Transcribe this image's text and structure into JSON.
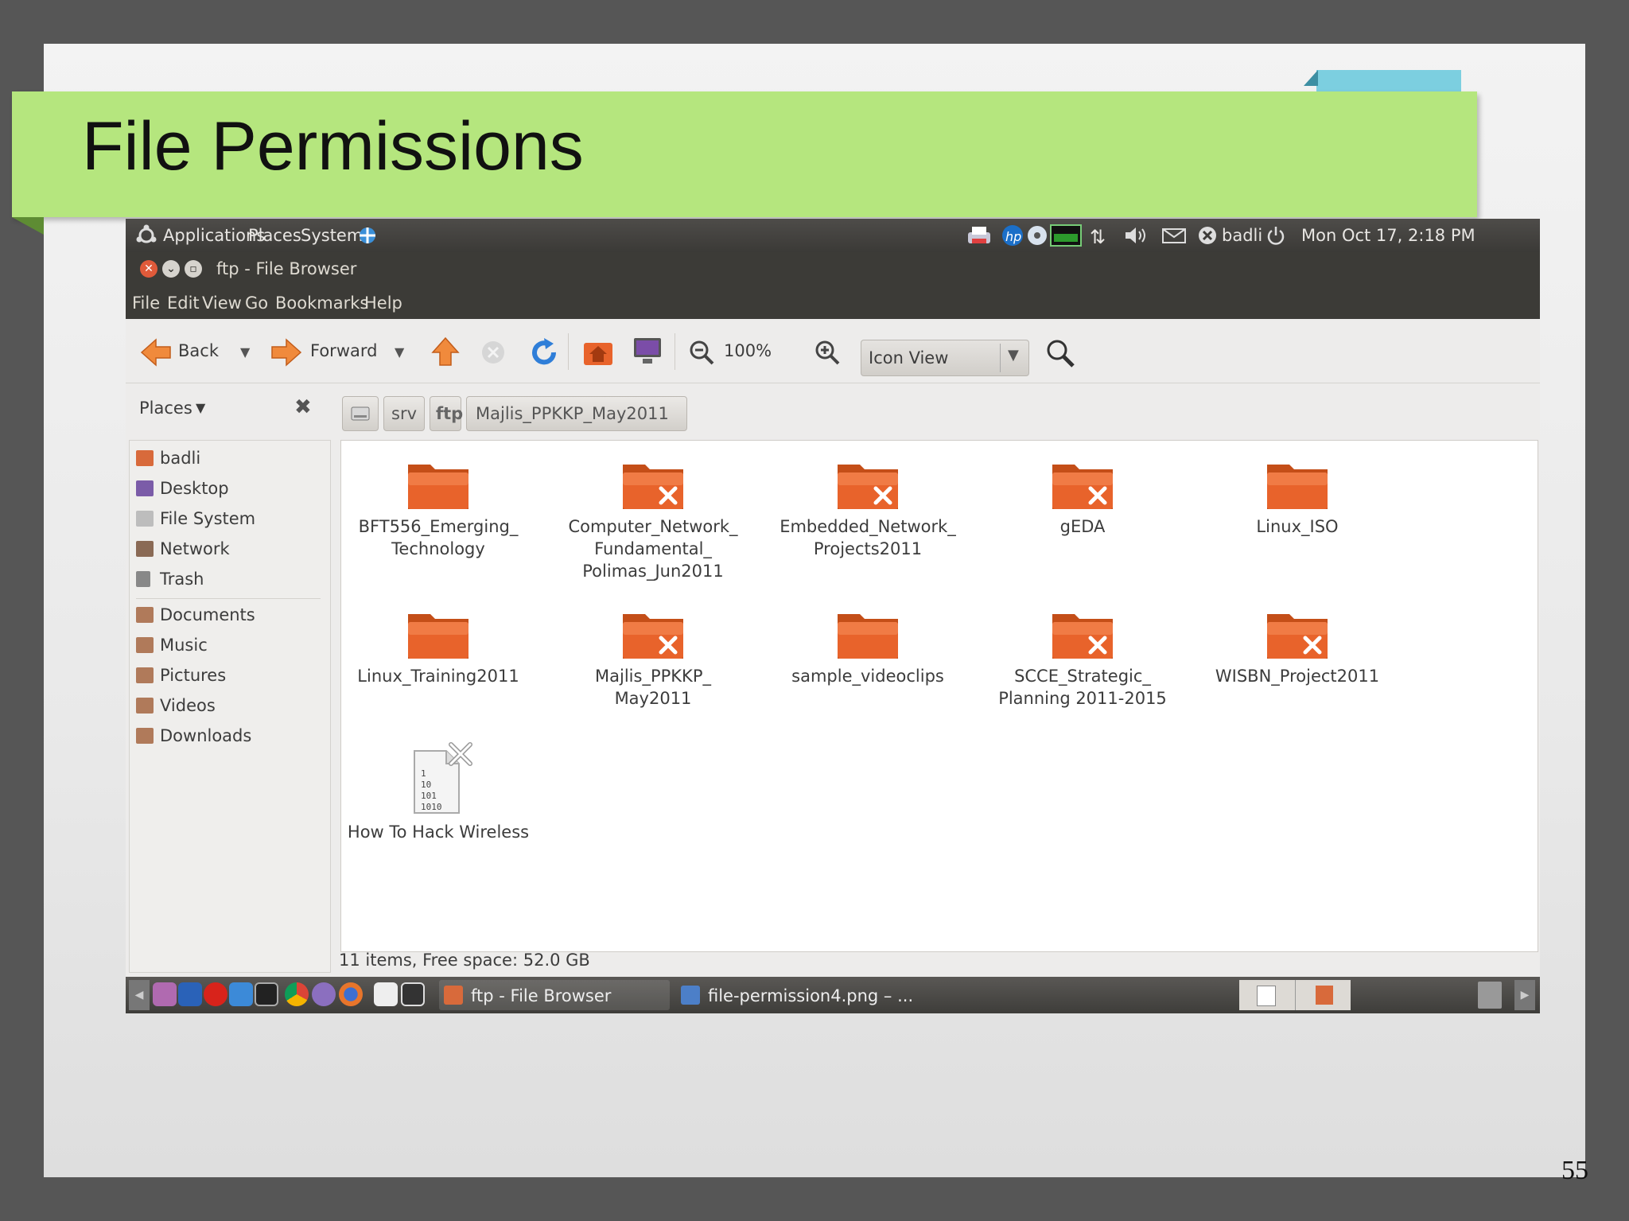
{
  "slide": {
    "title": "File Permissions",
    "page_number": "55"
  },
  "top_panel": {
    "menus": [
      "Applications",
      "Places",
      "System"
    ],
    "user": "badli",
    "datetime": "Mon Oct 17,  2:18 PM"
  },
  "window": {
    "title": "ftp - File Browser",
    "menu": [
      "File",
      "Edit",
      "View",
      "Go",
      "Bookmarks",
      "Help"
    ]
  },
  "toolbar": {
    "back_label": "Back",
    "forward_label": "Forward",
    "zoom_level": "100%",
    "view_mode": "Icon View"
  },
  "places": {
    "header": "Places",
    "items": [
      {
        "label": "badli",
        "icon": "home-folder-icon",
        "color": "#d86a3b"
      },
      {
        "label": "Desktop",
        "icon": "desktop-icon",
        "color": "#7b5ca8"
      },
      {
        "label": "File System",
        "icon": "drive-icon",
        "color": "#9a9a9a"
      },
      {
        "label": "Network",
        "icon": "network-icon",
        "color": "#8a6a55"
      },
      {
        "label": "Trash",
        "icon": "trash-icon",
        "color": "#888888"
      },
      {
        "label": "Documents",
        "icon": "documents-folder-icon",
        "color": "#b07a5a"
      },
      {
        "label": "Music",
        "icon": "music-folder-icon",
        "color": "#b07a5a"
      },
      {
        "label": "Pictures",
        "icon": "pictures-folder-icon",
        "color": "#b07a5a"
      },
      {
        "label": "Videos",
        "icon": "videos-folder-icon",
        "color": "#b07a5a"
      },
      {
        "label": "Downloads",
        "icon": "downloads-folder-icon",
        "color": "#b07a5a"
      }
    ]
  },
  "pathbar": {
    "crumbs": [
      "srv",
      "ftp",
      "Majlis_PPKKP_May2011"
    ]
  },
  "files": [
    {
      "name": "BFT556_Emerging_\nTechnology",
      "type": "folder",
      "locked": false
    },
    {
      "name": "Computer_Network_\nFundamental_\nPolimas_Jun2011",
      "type": "folder",
      "locked": true
    },
    {
      "name": "Embedded_Network_\nProjects2011",
      "type": "folder",
      "locked": true
    },
    {
      "name": "gEDA",
      "type": "folder",
      "locked": true
    },
    {
      "name": "Linux_ISO",
      "type": "folder",
      "locked": false
    },
    {
      "name": "Linux_Training2011",
      "type": "folder",
      "locked": false
    },
    {
      "name": "Majlis_PPKKP_\nMay2011",
      "type": "folder",
      "locked": true
    },
    {
      "name": "sample_videoclips",
      "type": "folder",
      "locked": false
    },
    {
      "name": "SCCE_Strategic_\nPlanning 2011-2015",
      "type": "folder",
      "locked": true
    },
    {
      "name": "WISBN_Project2011",
      "type": "folder",
      "locked": true
    },
    {
      "name": "How To Hack Wireless",
      "type": "binary-file",
      "locked": true
    }
  ],
  "binary_glyphs": [
    "1",
    "10",
    "101",
    "1010"
  ],
  "status": "11 items, Free space: 52.0 GB",
  "taskbar": {
    "tasks": [
      "ftp - File Browser",
      "file-permission4.png – ..."
    ]
  },
  "colors": {
    "title_band": "#b5e67e",
    "folder": "#e8632b",
    "accent_blue": "#7ccfe0"
  }
}
